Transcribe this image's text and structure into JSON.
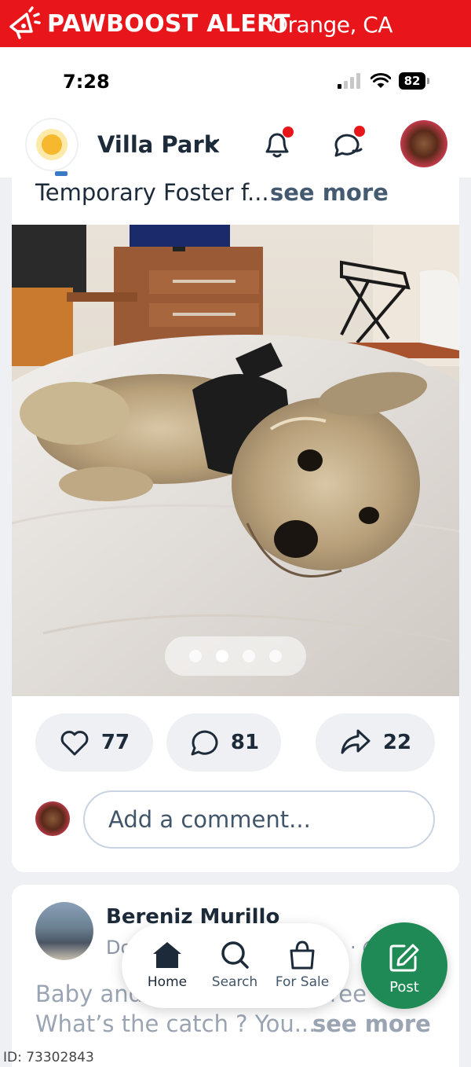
{
  "alert": {
    "title": "PAWBOOST ALERT",
    "location": "Orange, CA"
  },
  "status_bar": {
    "time": "7:28",
    "battery": "82"
  },
  "header": {
    "location": "Villa Park"
  },
  "post1": {
    "text": "Temporary Foster f...",
    "see_more": "see more",
    "photo_count": 4,
    "active_photo_index": 1,
    "likes": "77",
    "comments": "81",
    "shares": "22",
    "comment_placeholder": "Add a comment..."
  },
  "post2": {
    "author": "Bereniz Murillo",
    "meta_left": "Do",
    "meta_right": "· @",
    "line1_left": "Baby and",
    "line1_right": "ree",
    "line2": "What’s the catch ? You...",
    "see_more": "see more"
  },
  "bottom_nav": {
    "home": "Home",
    "search": "Search",
    "for_sale": "For Sale",
    "post": "Post"
  },
  "image_id": "ID: 73302843",
  "colors": {
    "alert_red": "#e8151b",
    "post_green": "#1f8a55",
    "text_dark": "#1d2a3a",
    "notification_red": "#e8151b"
  }
}
